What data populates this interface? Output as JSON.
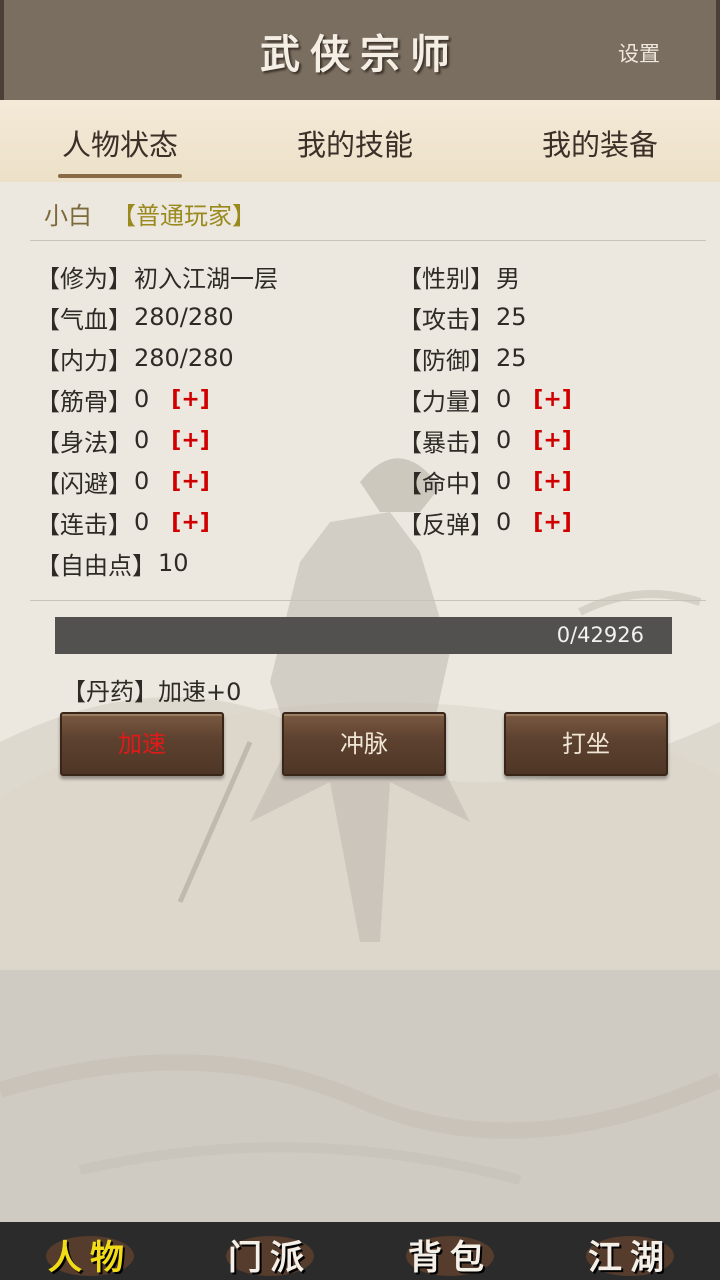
{
  "header": {
    "title": "武侠宗师",
    "settings_label": "设置"
  },
  "tabs": [
    {
      "label": "人物状态",
      "active": true
    },
    {
      "label": "我的技能",
      "active": false
    },
    {
      "label": "我的装备",
      "active": false
    }
  ],
  "player": {
    "name": "小白",
    "rank": "【普通玩家】"
  },
  "stats_left": [
    {
      "label": "【修为】",
      "value": "初入江湖一层"
    },
    {
      "label": "【气血】",
      "value": "280/280"
    },
    {
      "label": "【内力】",
      "value": "280/280"
    },
    {
      "label": "【筋骨】",
      "value": "0",
      "plus": "[+]"
    },
    {
      "label": "【身法】",
      "value": "0",
      "plus": "[+]"
    },
    {
      "label": "【闪避】",
      "value": "0",
      "plus": "[+]"
    },
    {
      "label": "【连击】",
      "value": "0",
      "plus": "[+]"
    },
    {
      "label": "【自由点】",
      "value": "10"
    }
  ],
  "stats_right": [
    {
      "label": "【性别】",
      "value": "男"
    },
    {
      "label": "【攻击】",
      "value": "25"
    },
    {
      "label": "【防御】",
      "value": "25"
    },
    {
      "label": "【力量】",
      "value": "0",
      "plus": "[+]"
    },
    {
      "label": "【暴击】",
      "value": "0",
      "plus": "[+]"
    },
    {
      "label": "【命中】",
      "value": "0",
      "plus": "[+]"
    },
    {
      "label": "【反弹】",
      "value": "0",
      "plus": "[+]"
    }
  ],
  "progress": {
    "text": "0/42926",
    "fraction": 0
  },
  "pill": {
    "label": "【丹药】",
    "value": "加速+0"
  },
  "buttons": {
    "speed": "加速",
    "meridian": "冲脉",
    "meditate": "打坐"
  },
  "nav": [
    {
      "label": "人物",
      "active": true
    },
    {
      "label": "门派",
      "active": false
    },
    {
      "label": "背包",
      "active": false
    },
    {
      "label": "江湖",
      "active": false
    }
  ],
  "colors": {
    "header_bg": "#7a6e60",
    "active_nav": "#f2dc18",
    "plus_red": "#d00000",
    "rank_color": "#9a8a1e"
  }
}
